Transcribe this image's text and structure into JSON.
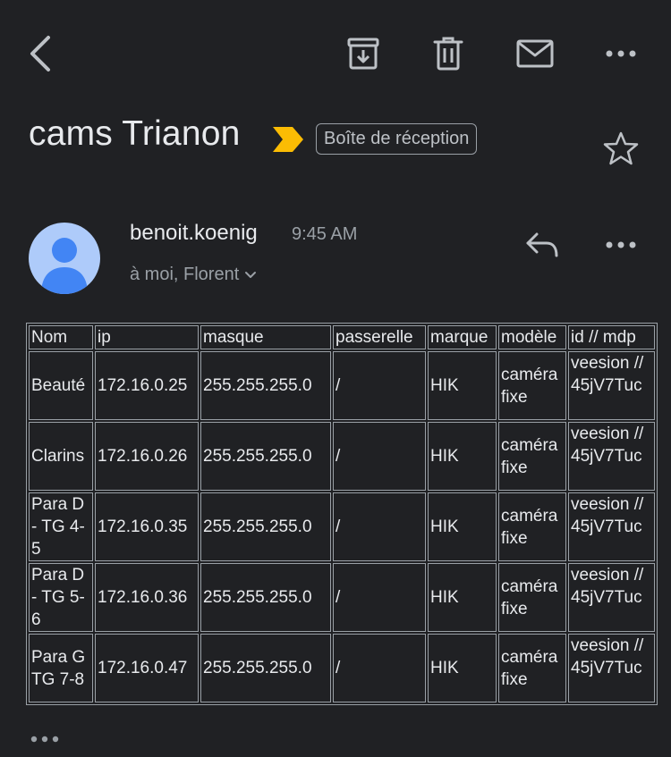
{
  "toolbar": {
    "back": "back-icon",
    "archive": "archive-icon",
    "delete": "trash-icon",
    "mark_unread": "mail-icon",
    "more": "more-horizontal-icon"
  },
  "subject": {
    "title": "cams Trianon",
    "label": "Boîte de réception",
    "importance_color": "#fbbc04"
  },
  "message": {
    "sender": "benoit.koenig",
    "time": "9:45 AM",
    "recipients": "à moi, Florent",
    "avatar_color": "#aecbfa",
    "avatar_figure_color": "#4285f4"
  },
  "table": {
    "headers": [
      "Nom",
      "ip",
      "masque",
      "passerelle",
      "marque",
      "modèle",
      "id // mdp"
    ],
    "rows": [
      {
        "nom": "Beauté",
        "ip": "172.16.0.25",
        "masque": "255.255.255.0",
        "passerelle": "/",
        "marque": "HIK",
        "modele": "caméra fixe",
        "id": "veesion // 45jV7Tuc"
      },
      {
        "nom": "Clarins",
        "ip": "172.16.0.26",
        "masque": "255.255.255.0",
        "passerelle": "/",
        "marque": "HIK",
        "modele": "caméra fixe",
        "id": "veesion // 45jV7Tuc"
      },
      {
        "nom": "Para D - TG 4-5",
        "ip": "172.16.0.35",
        "masque": "255.255.255.0",
        "passerelle": "/",
        "marque": "HIK",
        "modele": "caméra fixe",
        "id": "veesion // 45jV7Tuc"
      },
      {
        "nom": "Para D - TG 5-6",
        "ip": "172.16.0.36",
        "masque": "255.255.255.0",
        "passerelle": "/",
        "marque": "HIK",
        "modele": "caméra fixe",
        "id": "veesion // 45jV7Tuc"
      },
      {
        "nom": "Para G TG 7-8",
        "ip": "172.16.0.47",
        "masque": "255.255.255.0",
        "passerelle": "/",
        "marque": "HIK",
        "modele": "caméra fixe",
        "id": "veesion // 45jV7Tuc"
      }
    ]
  },
  "footer": {
    "show_trimmed": "more-horizontal-icon"
  }
}
